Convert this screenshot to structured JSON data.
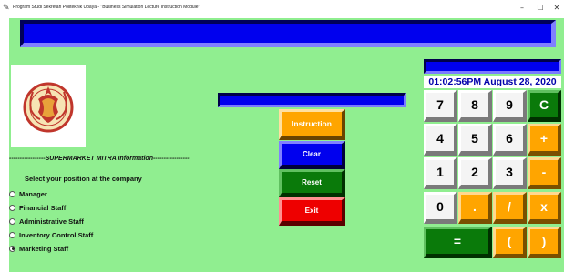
{
  "window": {
    "title": "Program Studi Sekretari Politeknik Ubaya - \"Business Simulation Lecture Instruction Module\"",
    "minimize_glyph": "–",
    "maximize_glyph": "☐",
    "close_glyph": "✕",
    "app_icon": "feather-icon"
  },
  "header": {
    "info_title": "-----------------SUPERMARKET MITRA Information-----------------",
    "clock": "01:02:56PM August 28, 2020"
  },
  "position_select": {
    "label": "Select your position at the company",
    "options": [
      {
        "label": "Manager",
        "checked": false
      },
      {
        "label": "Financial Staff",
        "checked": false
      },
      {
        "label": "Administrative Staff",
        "checked": false
      },
      {
        "label": "Inventory Control Staff",
        "checked": false
      },
      {
        "label": "Marketing Staff",
        "checked": true
      }
    ]
  },
  "actions": {
    "instruction": "Instruction",
    "clear": "Clear",
    "reset": "Reset",
    "exit": "Exit"
  },
  "calculator": {
    "display_value": "",
    "keys": {
      "k7": "7",
      "k8": "8",
      "k9": "9",
      "kC": "C",
      "k4": "4",
      "k5": "5",
      "k6": "6",
      "kplus": "+",
      "k1": "1",
      "k2": "2",
      "k3": "3",
      "kminus": "-",
      "k0": "0",
      "kdot": ".",
      "kdiv": "/",
      "kmul": "x",
      "keq": "=",
      "klparen": "(",
      "krparen": ")"
    }
  },
  "colors": {
    "background": "#90ee90",
    "banner_blue": "#0000ee",
    "orange": "#ffa500",
    "green": "#0a7a0a",
    "red": "#ee0000",
    "clock_text": "#0000aa"
  }
}
